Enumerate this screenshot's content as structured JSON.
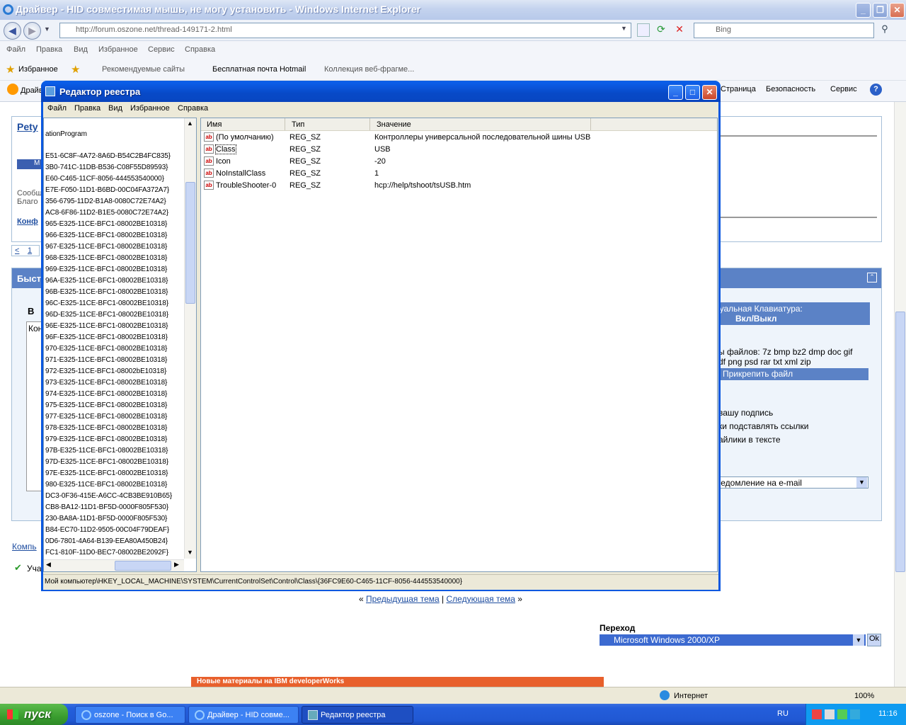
{
  "ie": {
    "title": "Драйвер - HID совместимая мышь, не могу установить - Windows Internet Explorer",
    "address": "http://forum.oszone.net/thread-149171-2.html",
    "search_placeholder": "Bing",
    "menu": [
      "Файл",
      "Правка",
      "Вид",
      "Избранное",
      "Сервис",
      "Справка"
    ],
    "favorites_label": "Избранное",
    "fav_links": [
      "Рекомендуемые сайты",
      "Бесплатная почта Hotmail",
      "Коллекция веб-фрагме..."
    ],
    "tab_label": "Драйв",
    "cmd": [
      "Страница",
      "Безопасность",
      "Сервис"
    ],
    "status_zone": "Интернет",
    "zoom": "100%"
  },
  "page": {
    "username": "Pety",
    "reply_prefix": "Сообщ",
    "thanks_prefix": "Благо",
    "config_link": "Конф",
    "pagination": [
      "<",
      "1"
    ],
    "quick_reply": "Быст",
    "bold_btn": "B",
    "input_prefix": "Кон",
    "vkb_title": "туальная Клавиатура:",
    "vkb_toggle": "Вкл/Выкл",
    "file_types_1": "ы файлов: 7z bmp bz2 dmp doc gif",
    "file_types_2": "df png psd rar txt xml zip",
    "attach_btn": "Прикрепить файл",
    "opt1": "вашу подпись",
    "opt2": "ки подставлять ссылки",
    "opt3": "айлики в тексте",
    "notify_select": "ведомление на e-mail",
    "comp_link": "Компь",
    "member_prefix": "Уча",
    "prev_topic": "Предыдущая тема",
    "next_topic": "Следующая тема",
    "goto_label": "Переход",
    "goto_select": "Microsoft Windows 2000/XP",
    "goto_ok": "Ok",
    "ibm_banner": "Новые материалы на IBM developerWorks"
  },
  "regedit": {
    "title": "Редактор реестра",
    "menu": [
      "Файл",
      "Правка",
      "Вид",
      "Избранное",
      "Справка"
    ],
    "tree_first": "ationProgram",
    "tree": [
      "E51-6C8F-4A72-8A6D-B54C2B4FC835}",
      "3B0-741C-11DB-B536-C08F55D89593}",
      "E60-C465-11CF-8056-444553540000}",
      "E7E-F050-11D1-B6BD-00C04FA372A7}",
      "356-6795-11D2-B1A8-0080C72E74A2}",
      "AC8-6F86-11D2-B1E5-0080C72E74A2}",
      "965-E325-11CE-BFC1-08002BE10318}",
      "966-E325-11CE-BFC1-08002BE10318}",
      "967-E325-11CE-BFC1-08002BE10318}",
      "968-E325-11CE-BFC1-08002BE10318}",
      "969-E325-11CE-BFC1-08002BE10318}",
      "96A-E325-11CE-BFC1-08002BE10318}",
      "96B-E325-11CE-BFC1-08002BE10318}",
      "96C-E325-11CE-BFC1-08002BE10318}",
      "96D-E325-11CE-BFC1-08002BE10318}",
      "96E-E325-11CE-BFC1-08002BE10318}",
      "96F-E325-11CE-BFC1-08002BE10318}",
      "970-E325-11CE-BFC1-08002BE10318}",
      "971-E325-11CE-BFC1-08002BE10318}",
      "972-E325-11CE-BFC1-08002bE10318}",
      "973-E325-11CE-BFC1-08002BE10318}",
      "974-E325-11CE-BFC1-08002BE10318}",
      "975-E325-11CE-BFC1-08002BE10318}",
      "977-E325-11CE-BFC1-08002BE10318}",
      "978-E325-11CE-BFC1-08002BE10318}",
      "979-E325-11CE-BFC1-08002BE10318}",
      "97B-E325-11CE-BFC1-08002BE10318}",
      "97D-E325-11CE-BFC1-08002BE10318}",
      "97E-E325-11CE-BFC1-08002BE10318}",
      "980-E325-11CE-BFC1-08002BE10318}",
      "DC3-0F36-415E-A6CC-4CB3BE910B65}",
      "CB8-BA12-11D1-BF5D-0000F805F530}",
      "230-BA8A-11D1-BF5D-0000F805F530}",
      "B84-EC70-11D2-9505-00C04F79DEAF}",
      "0D6-7801-4A64-B139-EEA80A450B24}",
      "FC1-810F-11D0-BEC7-08002BE2092F}"
    ],
    "columns": [
      "Имя",
      "Тип",
      "Значение"
    ],
    "values": [
      {
        "name": "(По умолчанию)",
        "type": "REG_SZ",
        "value": "Контроллеры универсальной последовательной шины USB"
      },
      {
        "name": "Class",
        "type": "REG_SZ",
        "value": "USB"
      },
      {
        "name": "Icon",
        "type": "REG_SZ",
        "value": "-20"
      },
      {
        "name": "NoInstallClass",
        "type": "REG_SZ",
        "value": "1"
      },
      {
        "name": "TroubleShooter-0",
        "type": "REG_SZ",
        "value": "hcp://help/tshoot/tsUSB.htm"
      }
    ],
    "status": "Мой компьютер\\HKEY_LOCAL_MACHINE\\SYSTEM\\CurrentControlSet\\Control\\Class\\{36FC9E60-C465-11CF-8056-444553540000}"
  },
  "taskbar": {
    "start": "пуск",
    "tasks": [
      "oszone - Поиск в Go...",
      "Драйвер - HID совме...",
      "Редактор реестра"
    ],
    "lang": "RU",
    "clock": "11:16"
  }
}
